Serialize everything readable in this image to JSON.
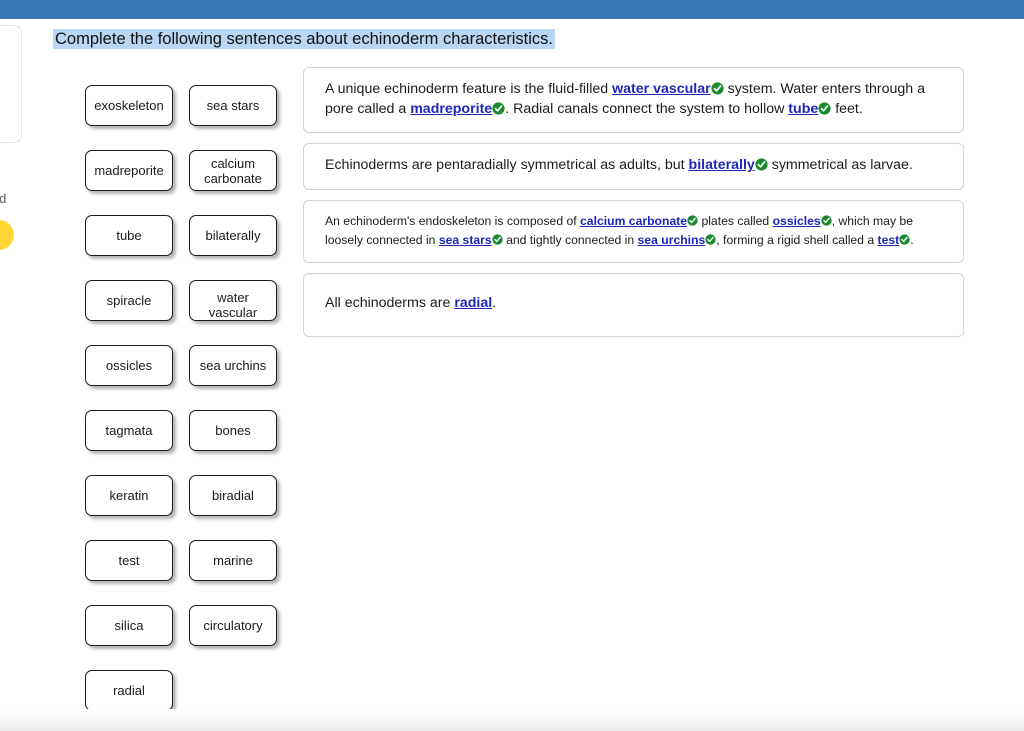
{
  "theme": {
    "header_bar_color": "#3a76b8",
    "title_highlight_color": "#b8d7f5",
    "link_color": "#1d27b8",
    "check_color": "#1a8a2e",
    "accent_dot_color": "#ffd633"
  },
  "header": {
    "bar_label": "top-blue-bar"
  },
  "left_rail": {
    "awarded_text": "rded",
    "dot_label": "progress-dot"
  },
  "question": {
    "title": "Complete the following sentences about echinoderm characteristics."
  },
  "word_bank": {
    "tiles": [
      {
        "label": "exoskeleton",
        "overflow": "x"
      },
      {
        "label": "sea stars",
        "overflow": "none"
      },
      {
        "label": "madreporite",
        "overflow": "x"
      },
      {
        "label": "calcium\ncarbonate",
        "overflow": "none"
      },
      {
        "label": "tube",
        "overflow": "none"
      },
      {
        "label": "bilaterally",
        "overflow": "none"
      },
      {
        "label": "spiracle",
        "overflow": "none"
      },
      {
        "label": "water\nvascular",
        "overflow": "y"
      },
      {
        "label": "ossicles",
        "overflow": "x"
      },
      {
        "label": "sea urchins",
        "overflow": "x"
      },
      {
        "label": "tagmata",
        "overflow": "none"
      },
      {
        "label": "bones",
        "overflow": "none"
      },
      {
        "label": "keratin",
        "overflow": "none"
      },
      {
        "label": "biradial",
        "overflow": "none"
      },
      {
        "label": "test",
        "overflow": "none"
      },
      {
        "label": "marine",
        "overflow": "none"
      },
      {
        "label": "silica",
        "overflow": "none"
      },
      {
        "label": "circulatory",
        "overflow": "x"
      },
      {
        "label": "radial",
        "overflow": "none"
      },
      {
        "label": "",
        "overflow": "none"
      }
    ]
  },
  "answers": {
    "boxes": [
      {
        "size": "normal",
        "tall": false,
        "segments": [
          {
            "type": "text",
            "text": "A unique echinoderm feature is the fluid-filled "
          },
          {
            "type": "blank",
            "text": "water vascular",
            "correct": true
          },
          {
            "type": "text",
            "text": " system. Water enters through a pore called a "
          },
          {
            "type": "blank",
            "text": "madreporite",
            "correct": true
          },
          {
            "type": "text",
            "text": ". Radial canals connect the system to hollow "
          },
          {
            "type": "blank",
            "text": "tube",
            "correct": true
          },
          {
            "type": "text",
            "text": " feet."
          }
        ]
      },
      {
        "size": "normal",
        "tall": false,
        "segments": [
          {
            "type": "text",
            "text": "Echinoderms are pentaradially symmetrical as adults, but "
          },
          {
            "type": "blank",
            "text": "bilaterally",
            "correct": true
          },
          {
            "type": "text",
            "text": " symmetrical as larvae."
          }
        ]
      },
      {
        "size": "small",
        "tall": false,
        "segments": [
          {
            "type": "text",
            "text": "An echinoderm's endoskeleton is composed of "
          },
          {
            "type": "blank",
            "text": "calcium carbonate",
            "correct": true
          },
          {
            "type": "text",
            "text": " plates called "
          },
          {
            "type": "blank",
            "text": "ossicles",
            "correct": true
          },
          {
            "type": "text",
            "text": ", which may be loosely connected in "
          },
          {
            "type": "blank",
            "text": "sea stars",
            "correct": true
          },
          {
            "type": "text",
            "text": " and tightly connected in "
          },
          {
            "type": "blank",
            "text": "sea urchins",
            "correct": true
          },
          {
            "type": "text",
            "text": ", forming a rigid shell called a "
          },
          {
            "type": "blank",
            "text": "test",
            "correct": true
          },
          {
            "type": "text",
            "text": "."
          }
        ]
      },
      {
        "size": "normal",
        "tall": true,
        "segments": [
          {
            "type": "text",
            "text": "All echinoderms are "
          },
          {
            "type": "blank",
            "text": "radial",
            "correct": false
          },
          {
            "type": "text",
            "text": "."
          }
        ]
      }
    ]
  }
}
